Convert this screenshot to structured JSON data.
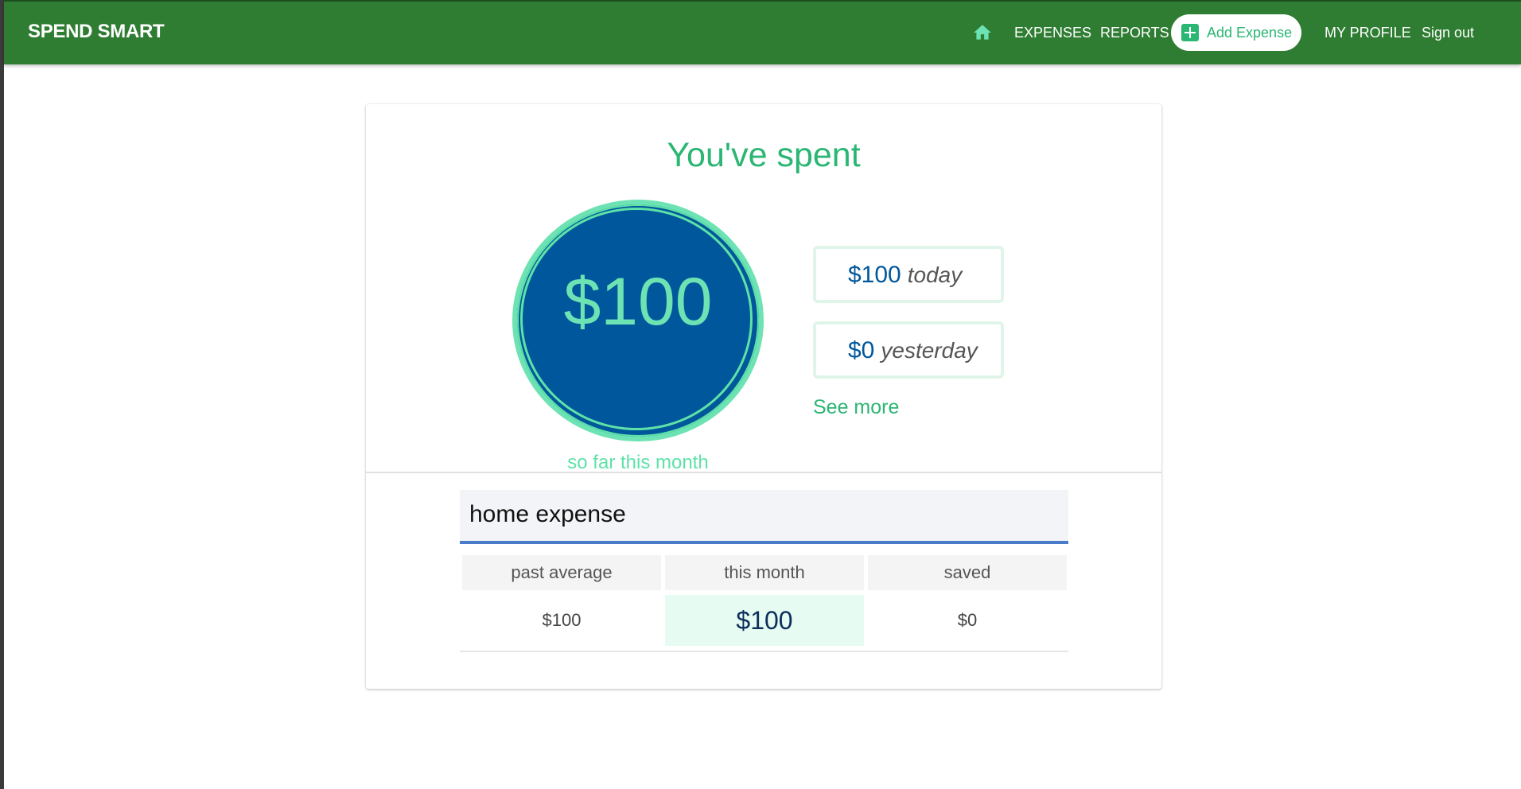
{
  "app": {
    "brand": "SPEND SMART"
  },
  "nav": {
    "home_icon": "home-icon",
    "expenses": "EXPENSES",
    "reports": "REPORTS",
    "add_expense": "Add Expense",
    "add_icon": "plus-box-icon",
    "my_profile": "MY PROFILE",
    "sign_out": "Sign out"
  },
  "summary": {
    "title": "You've spent",
    "month_total": "$100",
    "month_caption": "so far this month",
    "today_value": "$100",
    "today_label": "today",
    "yesterday_value": "$0",
    "yesterday_label": "yesterday",
    "see_more": "See more"
  },
  "category": {
    "name": "home expense",
    "headers": [
      "past average",
      "this month",
      "saved"
    ],
    "values": [
      "$100",
      "$100",
      "$0"
    ]
  },
  "colors": {
    "nav_bg": "#2e7d32",
    "accent_green": "#2bb673",
    "circle_fill": "#01579b",
    "circle_ring": "#6de3b4",
    "field_underline": "#4a7cc9"
  }
}
